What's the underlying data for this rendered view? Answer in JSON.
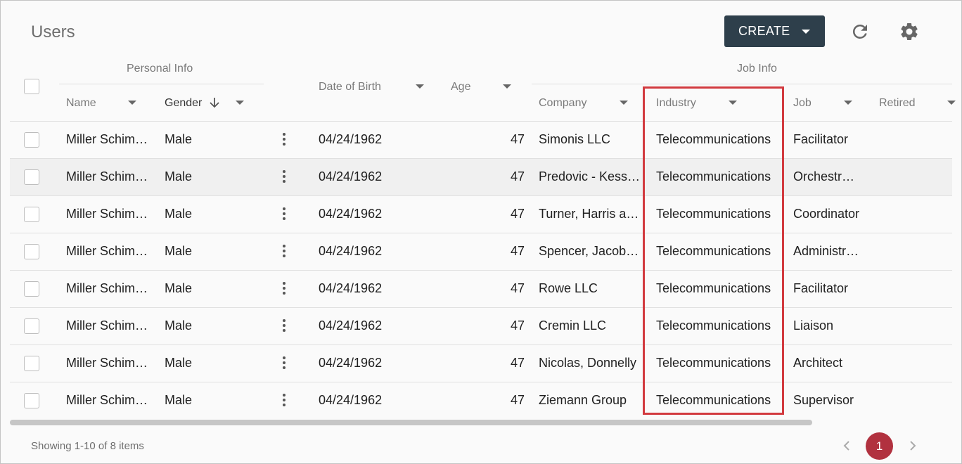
{
  "header": {
    "title": "Users",
    "create_label": "CREATE"
  },
  "columns": {
    "group_personal": "Personal Info",
    "group_job": "Job Info",
    "name": "Name",
    "gender": "Gender",
    "dob": "Date of Birth",
    "age": "Age",
    "company": "Company",
    "industry": "Industry",
    "job": "Job",
    "retired": "Retired"
  },
  "rows": [
    {
      "name": "Miller Schimmel",
      "gender": "Male",
      "dob": "04/24/1962",
      "age": "47",
      "company": "Simonis LLC",
      "industry": "Telecommunications",
      "job": "Facilitator"
    },
    {
      "name": "Miller Schimmel",
      "gender": "Male",
      "dob": "04/24/1962",
      "age": "47",
      "company": "Predovic - Kessler",
      "industry": "Telecommunications",
      "job": "Orchestrator"
    },
    {
      "name": "Miller Schimmel",
      "gender": "Male",
      "dob": "04/24/1962",
      "age": "47",
      "company": "Turner, Harris and Sons",
      "industry": "Telecommunications",
      "job": "Coordinator"
    },
    {
      "name": "Miller Schimmel",
      "gender": "Male",
      "dob": "04/24/1962",
      "age": "47",
      "company": "Spencer, Jacobson",
      "industry": "Telecommunications",
      "job": "Administrator"
    },
    {
      "name": "Miller Schimmel",
      "gender": "Male",
      "dob": "04/24/1962",
      "age": "47",
      "company": "Rowe LLC",
      "industry": "Telecommunications",
      "job": "Facilitator"
    },
    {
      "name": "Miller Schimmel",
      "gender": "Male",
      "dob": "04/24/1962",
      "age": "47",
      "company": "Cremin LLC",
      "industry": "Telecommunications",
      "job": "Liaison"
    },
    {
      "name": "Miller Schimmel",
      "gender": "Male",
      "dob": "04/24/1962",
      "age": "47",
      "company": "Nicolas, Donnelly",
      "industry": "Telecommunications",
      "job": "Architect"
    },
    {
      "name": "Miller Schimmel",
      "gender": "Male",
      "dob": "04/24/1962",
      "age": "47",
      "company": "Ziemann Group",
      "industry": "Telecommunications",
      "job": "Supervisor"
    }
  ],
  "footer": {
    "summary": "Showing 1-10 of 8 items",
    "current_page": "1"
  },
  "colors": {
    "create_button": "#2e3f4b",
    "highlight": "#d23a3f",
    "active_page": "#b1313f"
  },
  "icons": {
    "refresh": "refresh-icon",
    "settings": "gear-icon",
    "row_menu": "kebab-icon",
    "sort": "arrow-down-icon"
  }
}
